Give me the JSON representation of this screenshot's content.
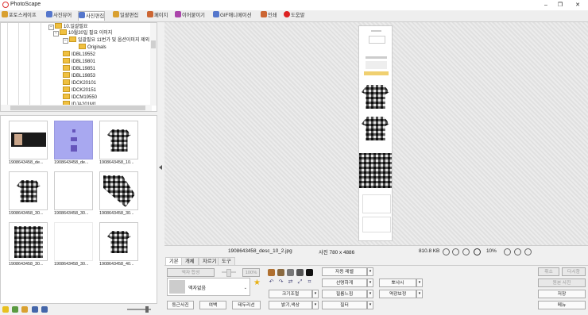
{
  "app": {
    "title": "PhotoScape"
  },
  "window_controls": [
    "–",
    "❐",
    "✕"
  ],
  "main_tabs": [
    {
      "label": "포토스케이프",
      "icon": "photoscape-icon",
      "color": "#d9a030"
    },
    {
      "label": "사진뷰어",
      "icon": "viewer-icon",
      "color": "#5577cc"
    },
    {
      "label": "사진편집",
      "icon": "editor-icon",
      "color": "#5577cc",
      "active": true
    },
    {
      "label": "일괄편집",
      "icon": "batch-icon",
      "color": "#d9a030"
    },
    {
      "label": "페이지",
      "icon": "page-icon",
      "color": "#cc6633"
    },
    {
      "label": "이어붙이기",
      "icon": "combine-icon",
      "color": "#aa44aa"
    },
    {
      "label": "GIF애니메이션",
      "icon": "gif-icon",
      "color": "#5577cc"
    },
    {
      "label": "인쇄",
      "icon": "print-icon",
      "color": "#cc6633"
    },
    {
      "label": "도움말",
      "icon": "help-icon",
      "color": "#dd2222"
    }
  ],
  "tree": {
    "items": [
      {
        "label": "10.일괄필요",
        "indent": 0,
        "expander": "−"
      },
      {
        "label": "10월20일 필요 이미지",
        "indent": 1,
        "expander": "−"
      },
      {
        "label": "일괄필요 11번가 및 옵션이미지 제외",
        "indent": 2,
        "expander": "−"
      },
      {
        "label": "Originals",
        "indent": 3,
        "expander": ""
      },
      {
        "label": "IDBL19552",
        "indent": 1,
        "expander": ""
      },
      {
        "label": "IDBL19801",
        "indent": 1,
        "expander": ""
      },
      {
        "label": "IDBL19851",
        "indent": 1,
        "expander": ""
      },
      {
        "label": "IDBL19853",
        "indent": 1,
        "expander": ""
      },
      {
        "label": "IDCK20101",
        "indent": 1,
        "expander": ""
      },
      {
        "label": "IDCK20151",
        "indent": 1,
        "expander": ""
      },
      {
        "label": "IDCM19550",
        "indent": 1,
        "expander": ""
      },
      {
        "label": "IDJA201M1",
        "indent": 1,
        "expander": ""
      }
    ]
  },
  "thumbnails": [
    {
      "caption": "1908643458_de...",
      "kind": "banner"
    },
    {
      "caption": "1908643458_de...",
      "kind": "selected"
    },
    {
      "caption": "1908643458_10...",
      "kind": "shirt"
    },
    {
      "caption": "1908643458_30...",
      "kind": "shirt"
    },
    {
      "caption": "1908643458_30...",
      "kind": "flat"
    },
    {
      "caption": "1908643458_30...",
      "kind": "sleeve"
    },
    {
      "caption": "1908643458_30...",
      "kind": "model"
    },
    {
      "caption": "1908643458_30...",
      "kind": "fabric"
    },
    {
      "caption": "1908643458_40...",
      "kind": "shirt"
    }
  ],
  "status": {
    "filename": "1908643458_desc_10_2.jpg",
    "size_label": "사진 780 x 4886",
    "filesize": "810.8 KB",
    "zoom": "10%"
  },
  "panel": {
    "tabs": [
      "기본",
      "개체",
      "자르기",
      "도구"
    ],
    "frame_fit_label": "액자 합성",
    "slider_value": "100%",
    "frame_value": "액자없음",
    "buttons_bottom": [
      "둥근사진",
      "여백",
      "테두리선"
    ],
    "col1": [
      "자동 레벨",
      "선명하게",
      "필름느낌",
      "필터"
    ],
    "col0": [
      "크기조절",
      "밝기,색상"
    ],
    "col2": [
      "뽀샤시",
      "역광보정"
    ],
    "right_buttons": [
      "취소",
      "다시함",
      "원본 사진",
      "저장",
      "메뉴"
    ]
  }
}
